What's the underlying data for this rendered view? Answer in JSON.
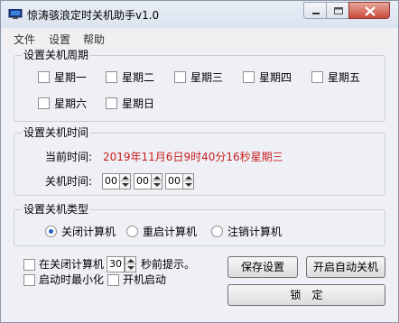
{
  "window": {
    "title": "惊涛骇浪定时关机助手v1.0"
  },
  "menu": [
    "文件",
    "设置",
    "帮助"
  ],
  "weekday_group": {
    "title": "设置关机周期",
    "days": [
      "星期一",
      "星期二",
      "星期三",
      "星期四",
      "星期五",
      "星期六",
      "星期日"
    ]
  },
  "time_group": {
    "title": "设置关机时间",
    "current_label": "当前时间:",
    "current_value": "2019年11月6日9时40分16秒星期三",
    "shutdown_label": "关机时间:",
    "hour": "00",
    "minute": "00",
    "second": "00"
  },
  "type_group": {
    "title": "设置关机类型",
    "options": [
      "关闭计算机",
      "重启计算机",
      "注销计算机"
    ],
    "selected_index": 0
  },
  "bottom": {
    "notify_prefix": "在关闭计算机",
    "notify_seconds": "30",
    "notify_suffix": "秒前提示。",
    "minimize_label": "启动时最小化",
    "autostart_label": "开机启动",
    "save_button": "保存设置",
    "autostart_button": "开启自动关机",
    "lock_button": "锁　定"
  },
  "colors": {
    "accent_red": "#c81e1e",
    "radio_selected": "#2a62c9"
  }
}
